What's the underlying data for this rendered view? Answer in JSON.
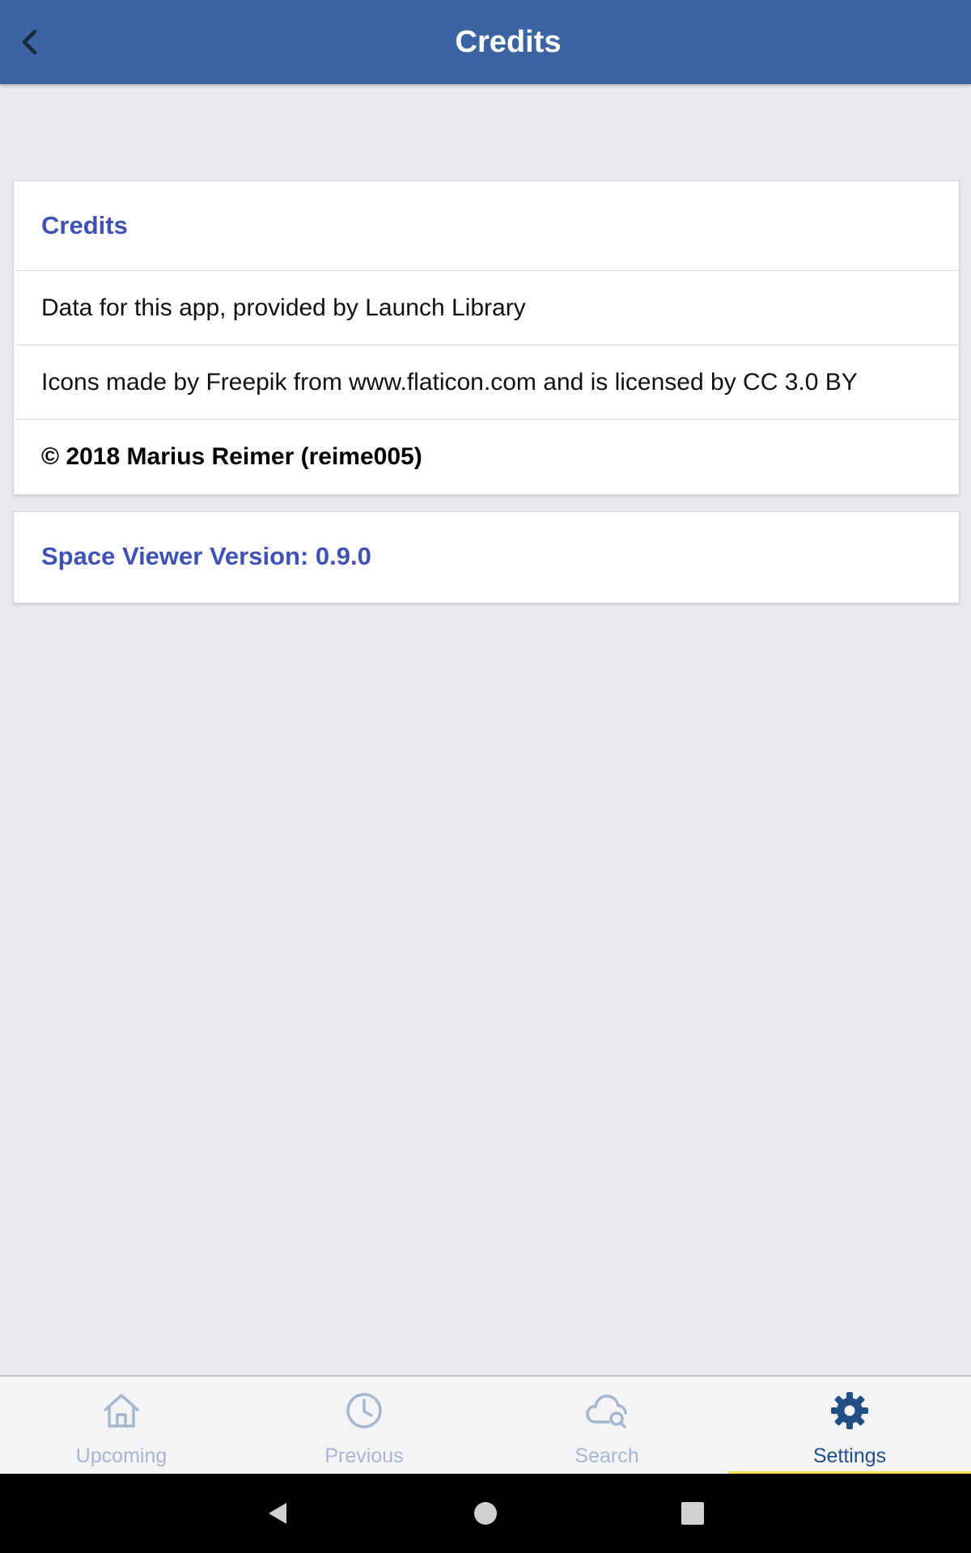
{
  "header": {
    "title": "Credits",
    "back_icon": "chevron-left-icon",
    "background_color": "#3b65a2"
  },
  "credits_card": {
    "heading": "Credits",
    "items": [
      "Data for this app, provided by Launch Library",
      "Icons made by Freepik from www.flaticon.com and is licensed by CC 3.0 BY"
    ],
    "copyright": "© 2018 Marius Reimer (reime005)"
  },
  "version_card": {
    "label": "Space Viewer Version: 0.9.0"
  },
  "tabbar": {
    "tabs": [
      {
        "label": "Upcoming",
        "icon": "home-icon",
        "active": false
      },
      {
        "label": "Previous",
        "icon": "clock-icon",
        "active": false
      },
      {
        "label": "Search",
        "icon": "cloud-search-icon",
        "active": false
      },
      {
        "label": "Settings",
        "icon": "gear-icon",
        "active": true
      }
    ],
    "active_color": "#1f4f85",
    "inactive_color": "#a7b6cf",
    "indicator_color": "#f5e14e"
  },
  "system_nav": {
    "buttons": [
      "back-triangle-icon",
      "home-circle-icon",
      "recents-square-icon"
    ]
  },
  "colors": {
    "accent_heading": "#3f51b5",
    "page_background": "#e9e9ee"
  }
}
